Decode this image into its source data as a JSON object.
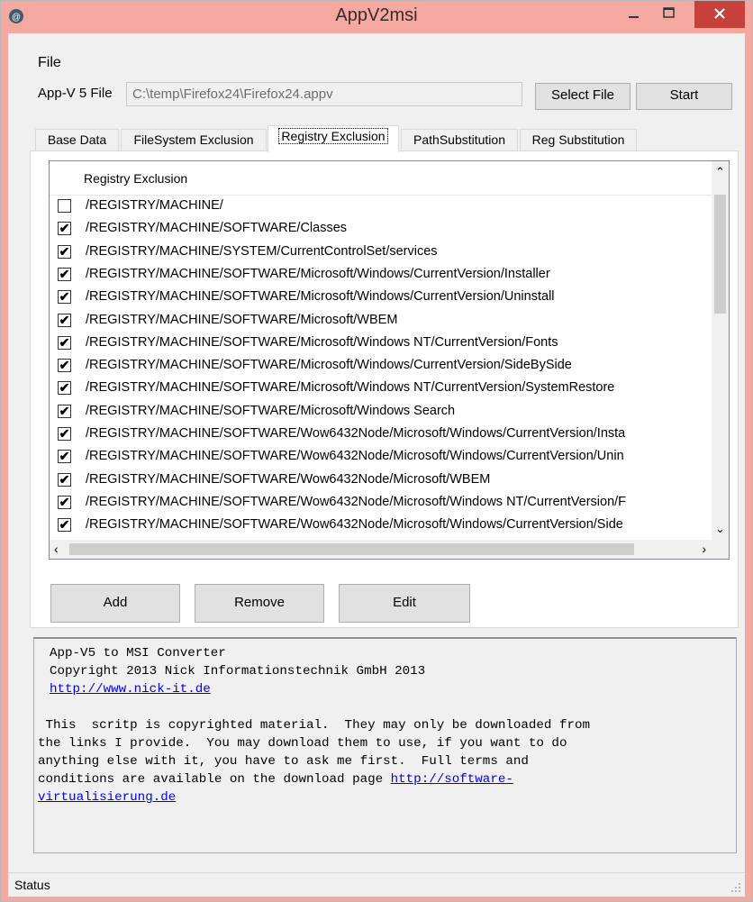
{
  "window": {
    "title": "AppV2msi",
    "colors": {
      "frame": "#f4a8a0",
      "close_button": "#c7413a"
    }
  },
  "menu": {
    "file": "File"
  },
  "appv_file": {
    "label": "App-V 5 File",
    "value": "C:\\temp\\Firefox24\\Firefox24.appv"
  },
  "buttons": {
    "select_file": "Select File",
    "start": "Start",
    "add": "Add",
    "remove": "Remove",
    "edit": "Edit"
  },
  "tabs": [
    {
      "label": "Base Data",
      "active": false
    },
    {
      "label": "FileSystem Exclusion",
      "active": false
    },
    {
      "label": "Registry Exclusion",
      "active": true
    },
    {
      "label": "PathSubstitution",
      "active": false
    },
    {
      "label": "Reg Substitution",
      "active": false
    }
  ],
  "registry_list": {
    "header": "Registry Exclusion",
    "rows": [
      {
        "checked": false,
        "path": "/REGISTRY/MACHINE/"
      },
      {
        "checked": true,
        "path": "/REGISTRY/MACHINE/SOFTWARE/Classes"
      },
      {
        "checked": true,
        "path": "/REGISTRY/MACHINE/SYSTEM/CurrentControlSet/services"
      },
      {
        "checked": true,
        "path": "/REGISTRY/MACHINE/SOFTWARE/Microsoft/Windows/CurrentVersion/Installer"
      },
      {
        "checked": true,
        "path": "/REGISTRY/MACHINE/SOFTWARE/Microsoft/Windows/CurrentVersion/Uninstall"
      },
      {
        "checked": true,
        "path": "/REGISTRY/MACHINE/SOFTWARE/Microsoft/WBEM"
      },
      {
        "checked": true,
        "path": "/REGISTRY/MACHINE/SOFTWARE/Microsoft/Windows NT/CurrentVersion/Fonts"
      },
      {
        "checked": true,
        "path": "/REGISTRY/MACHINE/SOFTWARE/Microsoft/Windows/CurrentVersion/SideBySide"
      },
      {
        "checked": true,
        "path": "/REGISTRY/MACHINE/SOFTWARE/Microsoft/Windows NT/CurrentVersion/SystemRestore"
      },
      {
        "checked": true,
        "path": "/REGISTRY/MACHINE/SOFTWARE/Microsoft/Windows Search"
      },
      {
        "checked": true,
        "path": "/REGISTRY/MACHINE/SOFTWARE/Wow6432Node/Microsoft/Windows/CurrentVersion/Insta"
      },
      {
        "checked": true,
        "path": "/REGISTRY/MACHINE/SOFTWARE/Wow6432Node/Microsoft/Windows/CurrentVersion/Unin"
      },
      {
        "checked": true,
        "path": "/REGISTRY/MACHINE/SOFTWARE/Wow6432Node/Microsoft/WBEM"
      },
      {
        "checked": true,
        "path": "/REGISTRY/MACHINE/SOFTWARE/Wow6432Node/Microsoft/Windows NT/CurrentVersion/F"
      },
      {
        "checked": true,
        "path": "/REGISTRY/MACHINE/SOFTWARE/Wow6432Node/Microsoft/Windows/CurrentVersion/Side"
      }
    ]
  },
  "output": {
    "line1": "App-V5 to MSI Converter",
    "line2": "Copyright 2013 Nick Informationstechnik GmbH 2013",
    "link1": "http://www.nick-it.de",
    "para1": " This  scritp is copyrighted material.  They may only be downloaded from",
    "para2": "the links I provide.  You may download them to use, if you want to do",
    "para3": "anything else with it, you have to ask me first.  Full terms and",
    "para4_text": "conditions are available on the download page ",
    "link2_part1": "http://software-",
    "link2_part2": "virtualisierung.de"
  },
  "status": {
    "text": "Status"
  }
}
